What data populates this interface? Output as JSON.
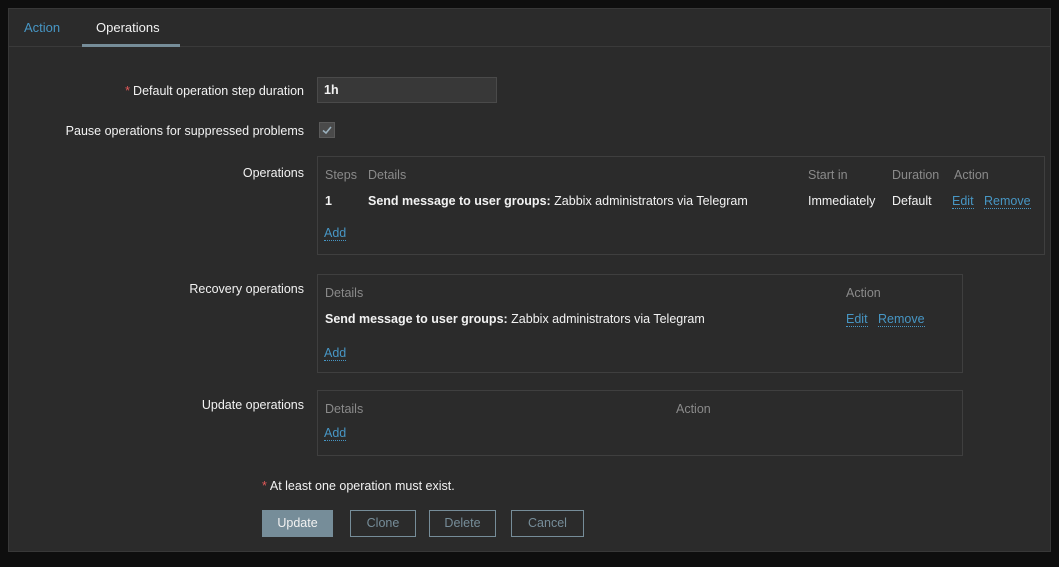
{
  "tabs": [
    {
      "label": "Action"
    },
    {
      "label": "Operations"
    }
  ],
  "form": {
    "step_duration": {
      "required_mark": "*",
      "label": "Default operation step duration",
      "value": "1h"
    },
    "pause_suppressed": {
      "label": "Pause operations for suppressed problems",
      "checked": true
    },
    "operations": {
      "label": "Operations",
      "headers": [
        "Steps",
        "Details",
        "Start in",
        "Duration",
        "Action"
      ],
      "rows": [
        {
          "step": "1",
          "detail_bold": "Send message to user groups:",
          "detail_rest": "Zabbix administrators via Telegram",
          "start_in": "Immediately",
          "duration": "Default",
          "edit": "Edit",
          "remove": "Remove"
        }
      ],
      "add_label": "Add"
    },
    "recovery_operations": {
      "label": "Recovery operations",
      "headers": [
        "Details",
        "Action"
      ],
      "rows": [
        {
          "detail_bold": "Send message to user groups:",
          "detail_rest": "Zabbix administrators via Telegram",
          "edit": "Edit",
          "remove": "Remove"
        }
      ],
      "add_label": "Add"
    },
    "update_operations": {
      "label": "Update operations",
      "headers": [
        "Details",
        "Action"
      ],
      "add_label": "Add"
    },
    "note": {
      "required_mark": "*",
      "text": "At least one operation must exist."
    }
  },
  "buttons": {
    "update": "Update",
    "clone": "Clone",
    "delete": "Delete",
    "cancel": "Cancel"
  },
  "colors": {
    "accent_link": "#4796c4",
    "required": "#e45959",
    "button": "#768d99",
    "background": "#2b2b2b"
  }
}
